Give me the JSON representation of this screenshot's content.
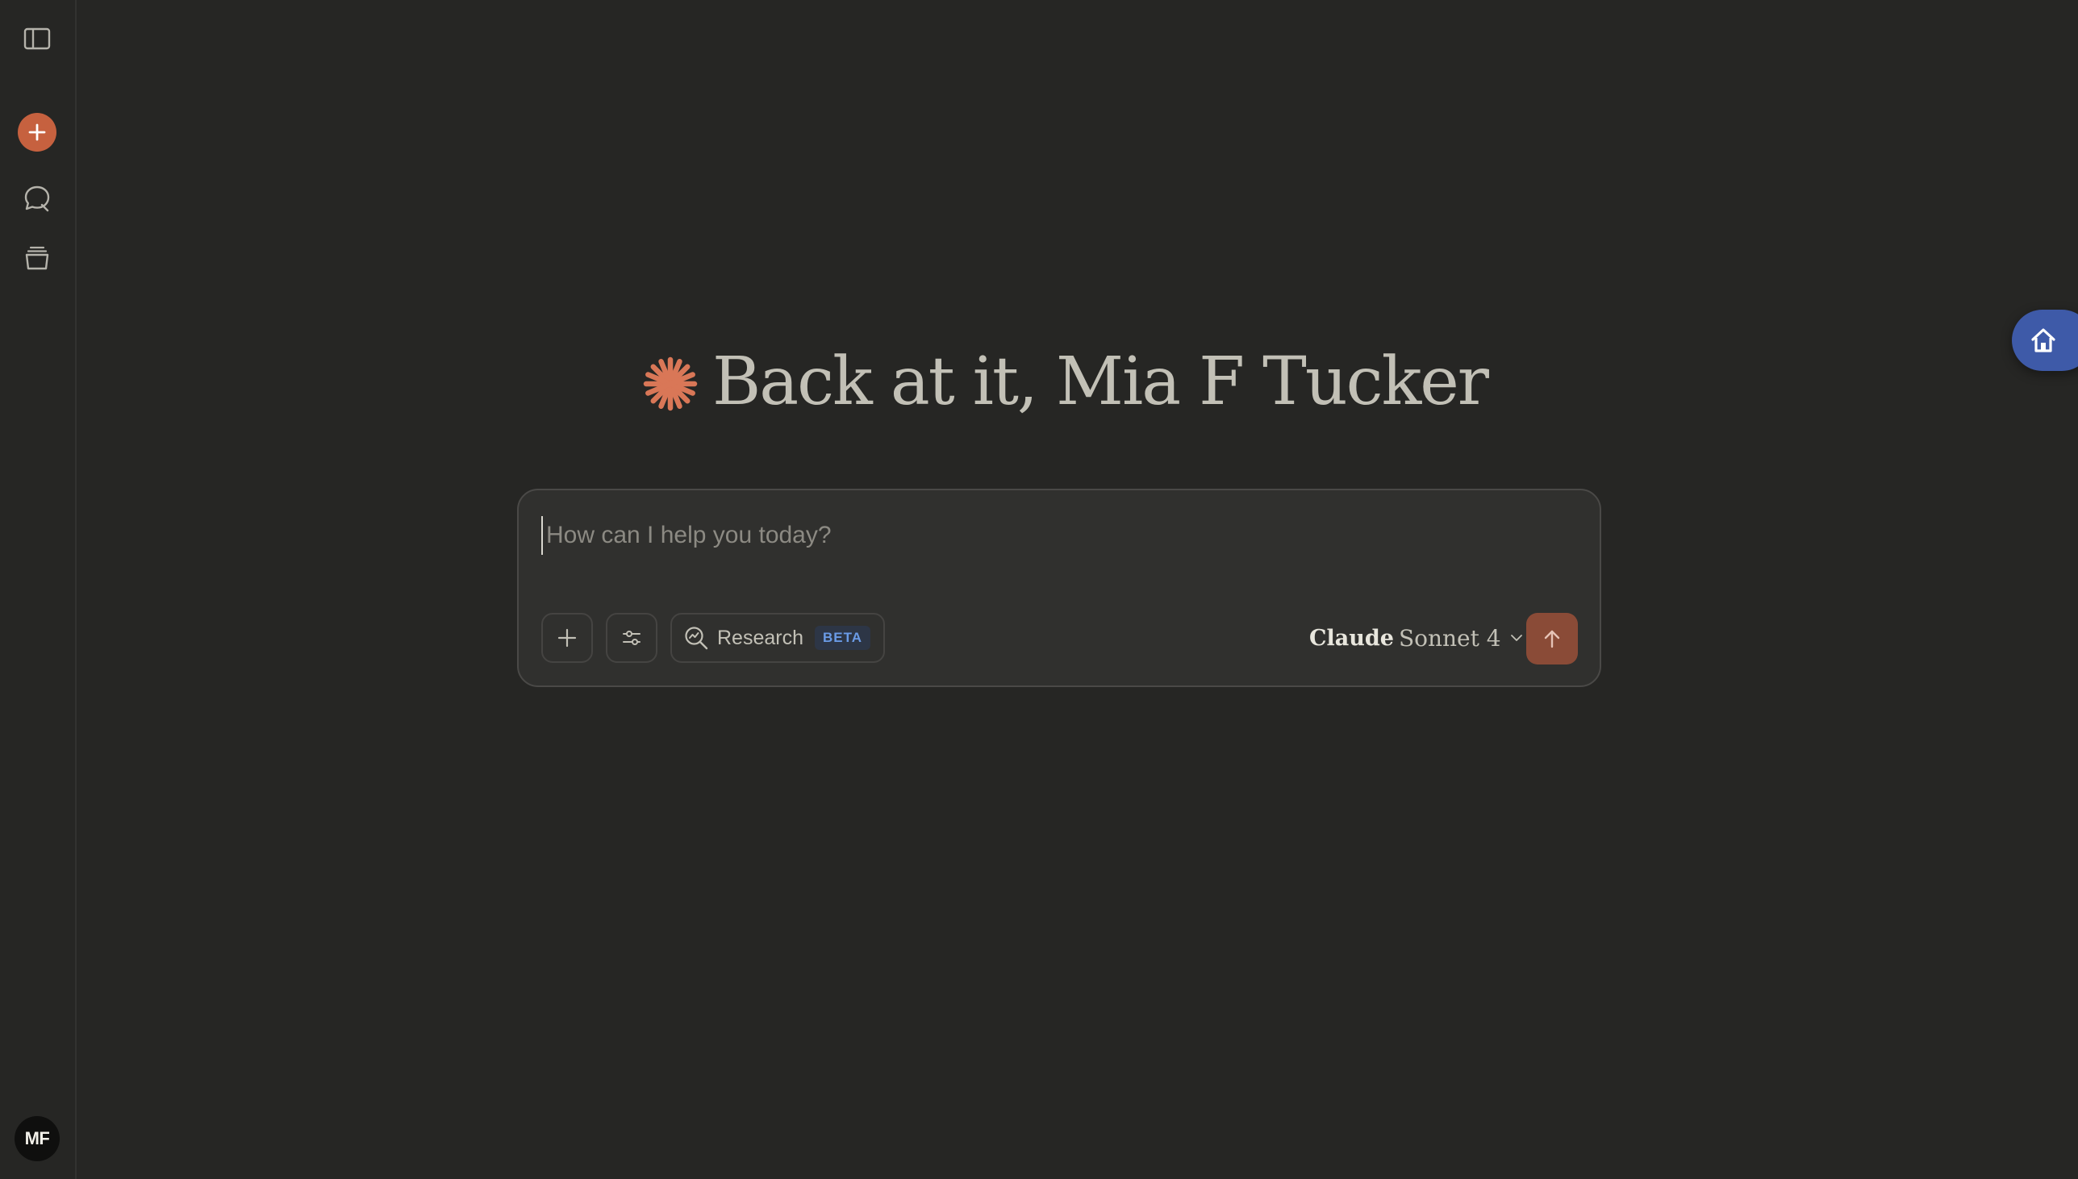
{
  "sidebar": {
    "toggle_icon": "sidebar-toggle-icon",
    "new_chat_icon": "plus-icon",
    "chats_icon": "chat-bubble-icon",
    "projects_icon": "archive-box-icon",
    "avatar_initials": "MF",
    "accent_color": "#c6613f"
  },
  "greeting": {
    "icon": "claude-spark-icon",
    "text": "Back at it, Mia F Tucker",
    "icon_color": "#d97757"
  },
  "composer": {
    "placeholder": "How can I help you today?",
    "value": "",
    "add_icon": "plus-icon",
    "tools_icon": "sliders-icon",
    "research": {
      "icon": "search-spark-icon",
      "label": "Research",
      "badge": "BETA"
    },
    "model": {
      "brand": "Claude",
      "name": "Sonnet 4",
      "chevron_icon": "chevron-down-icon"
    },
    "send_icon": "arrow-up-icon",
    "send_color": "#8a4b37"
  },
  "floating": {
    "home_icon": "home-icon",
    "color": "#3e5aa8"
  }
}
